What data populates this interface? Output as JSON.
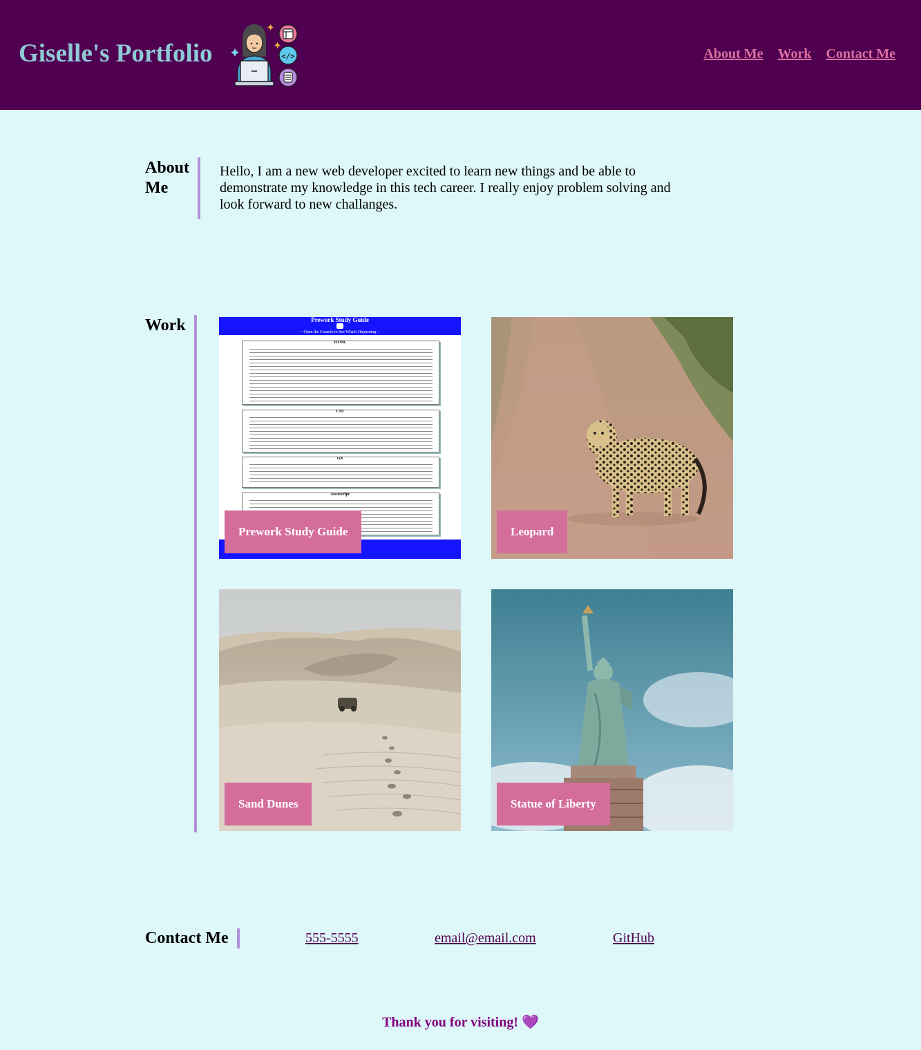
{
  "header": {
    "title": "Giselle's Portfolio",
    "logo_icon": "developer-avatar-icon",
    "nav": [
      {
        "label": "About Me"
      },
      {
        "label": "Work"
      },
      {
        "label": "Contact Me"
      }
    ]
  },
  "about": {
    "heading": "About Me",
    "text": "Hello, I am a new web developer excited to learn new things and be able to demonstrate my knowledge in this tech career. I really enjoy problem solving and look forward to new challanges."
  },
  "work": {
    "heading": "Work",
    "items": [
      {
        "caption": "Prework Study Guide"
      },
      {
        "caption": "Leopard"
      },
      {
        "caption": "Sand Dunes"
      },
      {
        "caption": "Statue of Liberty"
      }
    ],
    "study_guide": {
      "title": "Prework Study Guide",
      "subtitle": "~ Open the Console to See What's Happening ~",
      "sections": [
        "HTML",
        "CSS",
        "Git",
        "JavaScript"
      ]
    }
  },
  "contact": {
    "heading": "Contact Me",
    "phone": "555-5555",
    "email": "email@email.com",
    "github": "GitHub"
  },
  "footer": {
    "text": "Thank you for visiting! 💜"
  },
  "colors": {
    "header_bg": "#500050",
    "page_bg": "#def7f9",
    "title": "#8fcad6",
    "nav_link": "#d96fa0",
    "accent_bar": "#b18fd9",
    "caption_bg": "#d46d9c",
    "footer_text": "#800080"
  }
}
